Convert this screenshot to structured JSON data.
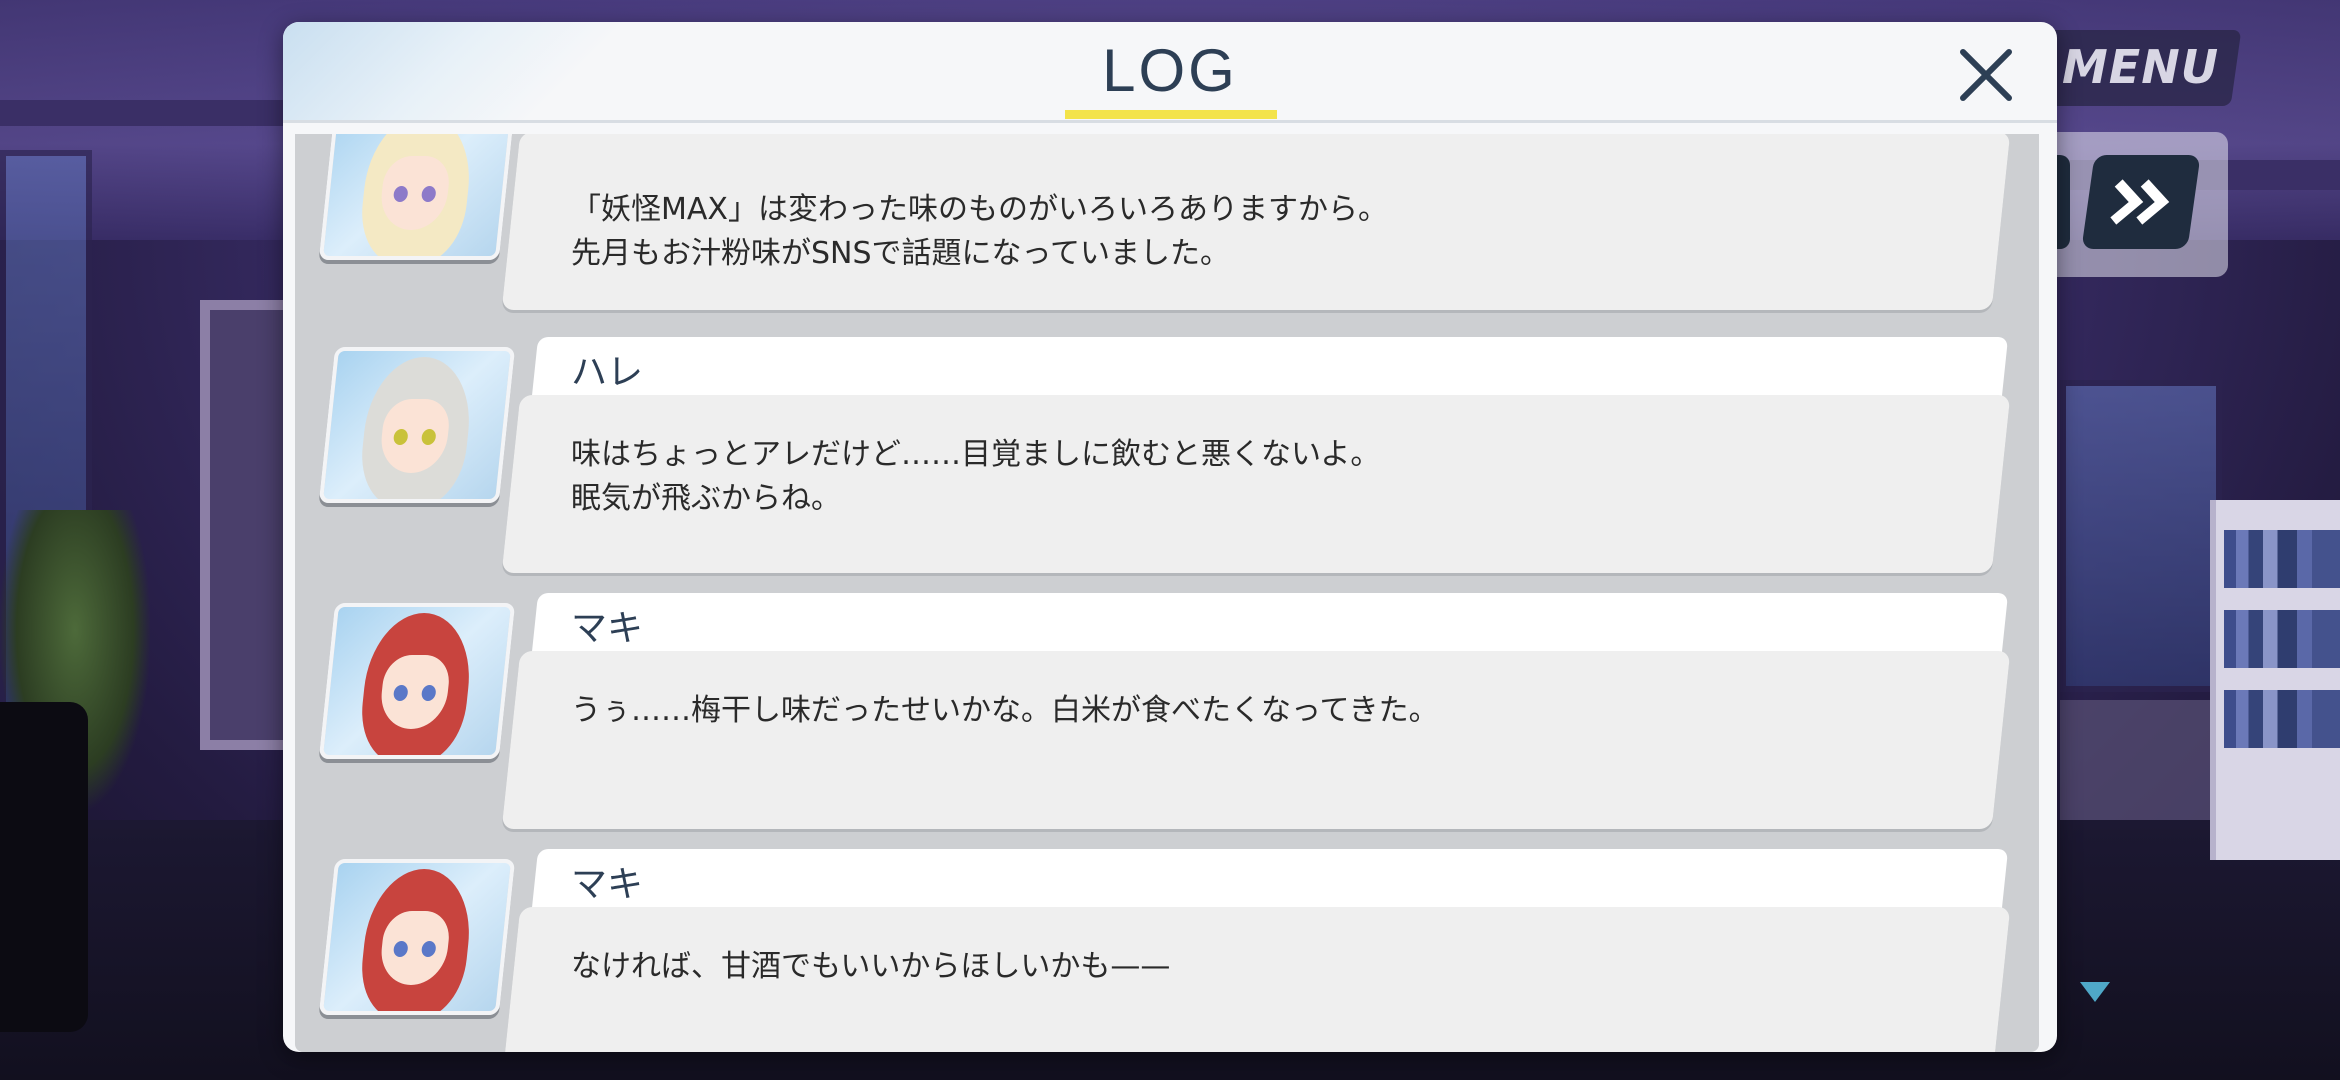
{
  "header": {
    "title": "LOG",
    "menu_label": "MENU"
  },
  "icons": {
    "close": "close-icon",
    "skip": "fast-forward-icon",
    "scroll_down": "triangle-down-icon"
  },
  "colors": {
    "accent_underline": "#f3e34a",
    "title_text": "#2d3f55"
  },
  "log_entries": [
    {
      "speaker": "",
      "lines": [
        "「妖怪MAX」は変わった味のものがいろいろありますから。",
        "先月もお汁粉味がSNSで話題になっていました。"
      ]
    },
    {
      "speaker": "ハレ",
      "lines": [
        "味はちょっとアレだけど……目覚ましに飲むと悪くないよ。",
        "眠気が飛ぶからね。"
      ]
    },
    {
      "speaker": "マキ",
      "lines": [
        "うぅ……梅干し味だったせいかな。白米が食べたくなってきた。"
      ]
    },
    {
      "speaker": "マキ",
      "lines": [
        "なければ、甘酒でもいいからほしいかも——"
      ]
    }
  ]
}
